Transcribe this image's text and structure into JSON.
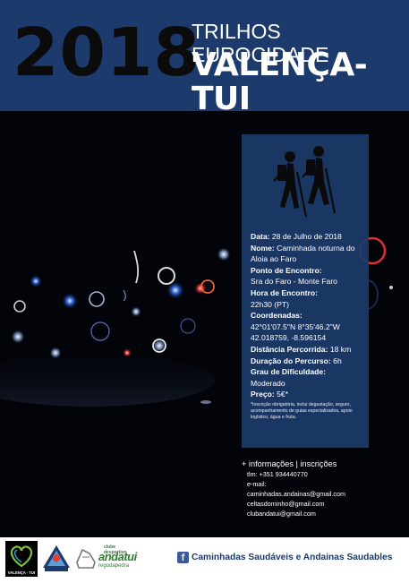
{
  "header": {
    "year": "2018",
    "title_line1": "TRILHOS EUROCIDADE",
    "title_line2": "VALENÇA-TUI"
  },
  "info": {
    "icon": "hikers-icon",
    "date_label": "Data:",
    "date_value": " 28 de Julho de 2018",
    "name_label": "Nome:",
    "name_value": " Caminhada noturna do Aloia ao Faro",
    "meeting_point_label": "Ponto de Encontro:",
    "meeting_point_value": "Sra do Faro - Monte Faro",
    "meeting_time_label": "Hora de Encontro:",
    "meeting_time_value": "22h30 (PT)",
    "coords_label": "Coordenadas:",
    "coords_dms": "42°01'07.5\"N 8°35'46.2\"W",
    "coords_decimal": "42.018759, -8.596154",
    "distance_label": "Distância Percorrida:",
    "distance_value": " 18 km",
    "duration_label": "Duração do Percurso:",
    "duration_value": " 6h",
    "difficulty_label": "Grau de Dificuldade:",
    "difficulty_value": "Moderado",
    "price_label": "Preço:",
    "price_value": " 5€*",
    "footnote": "*Inscrição obrigatória, inclui degustação, seguro, acompanhamento de guias especializados, apoio logístico, água e fruta."
  },
  "contact": {
    "heading": "+ informações | inscrições",
    "phone": "tlm: +351 934440770",
    "email_label": "e-mail:",
    "emails": [
      "caminhadas.andainas@gmail.com",
      "celtasdominho@gmail.com",
      "clubandatui@gmail.com"
    ]
  },
  "footer": {
    "logo1_text": "VALENÇA - TUI",
    "logo3_small": "clube desportivo",
    "logo3_big": "andatui",
    "logo3_sub": "regodapedra",
    "facebook_icon": "facebook-icon",
    "facebook_text": "Caminhadas Saudáveis e Andainas Saudables"
  },
  "colors": {
    "header_bg": "#1c3a6b",
    "panel_bg": "#1c3a6b",
    "facebook_blue": "#3b5998"
  }
}
